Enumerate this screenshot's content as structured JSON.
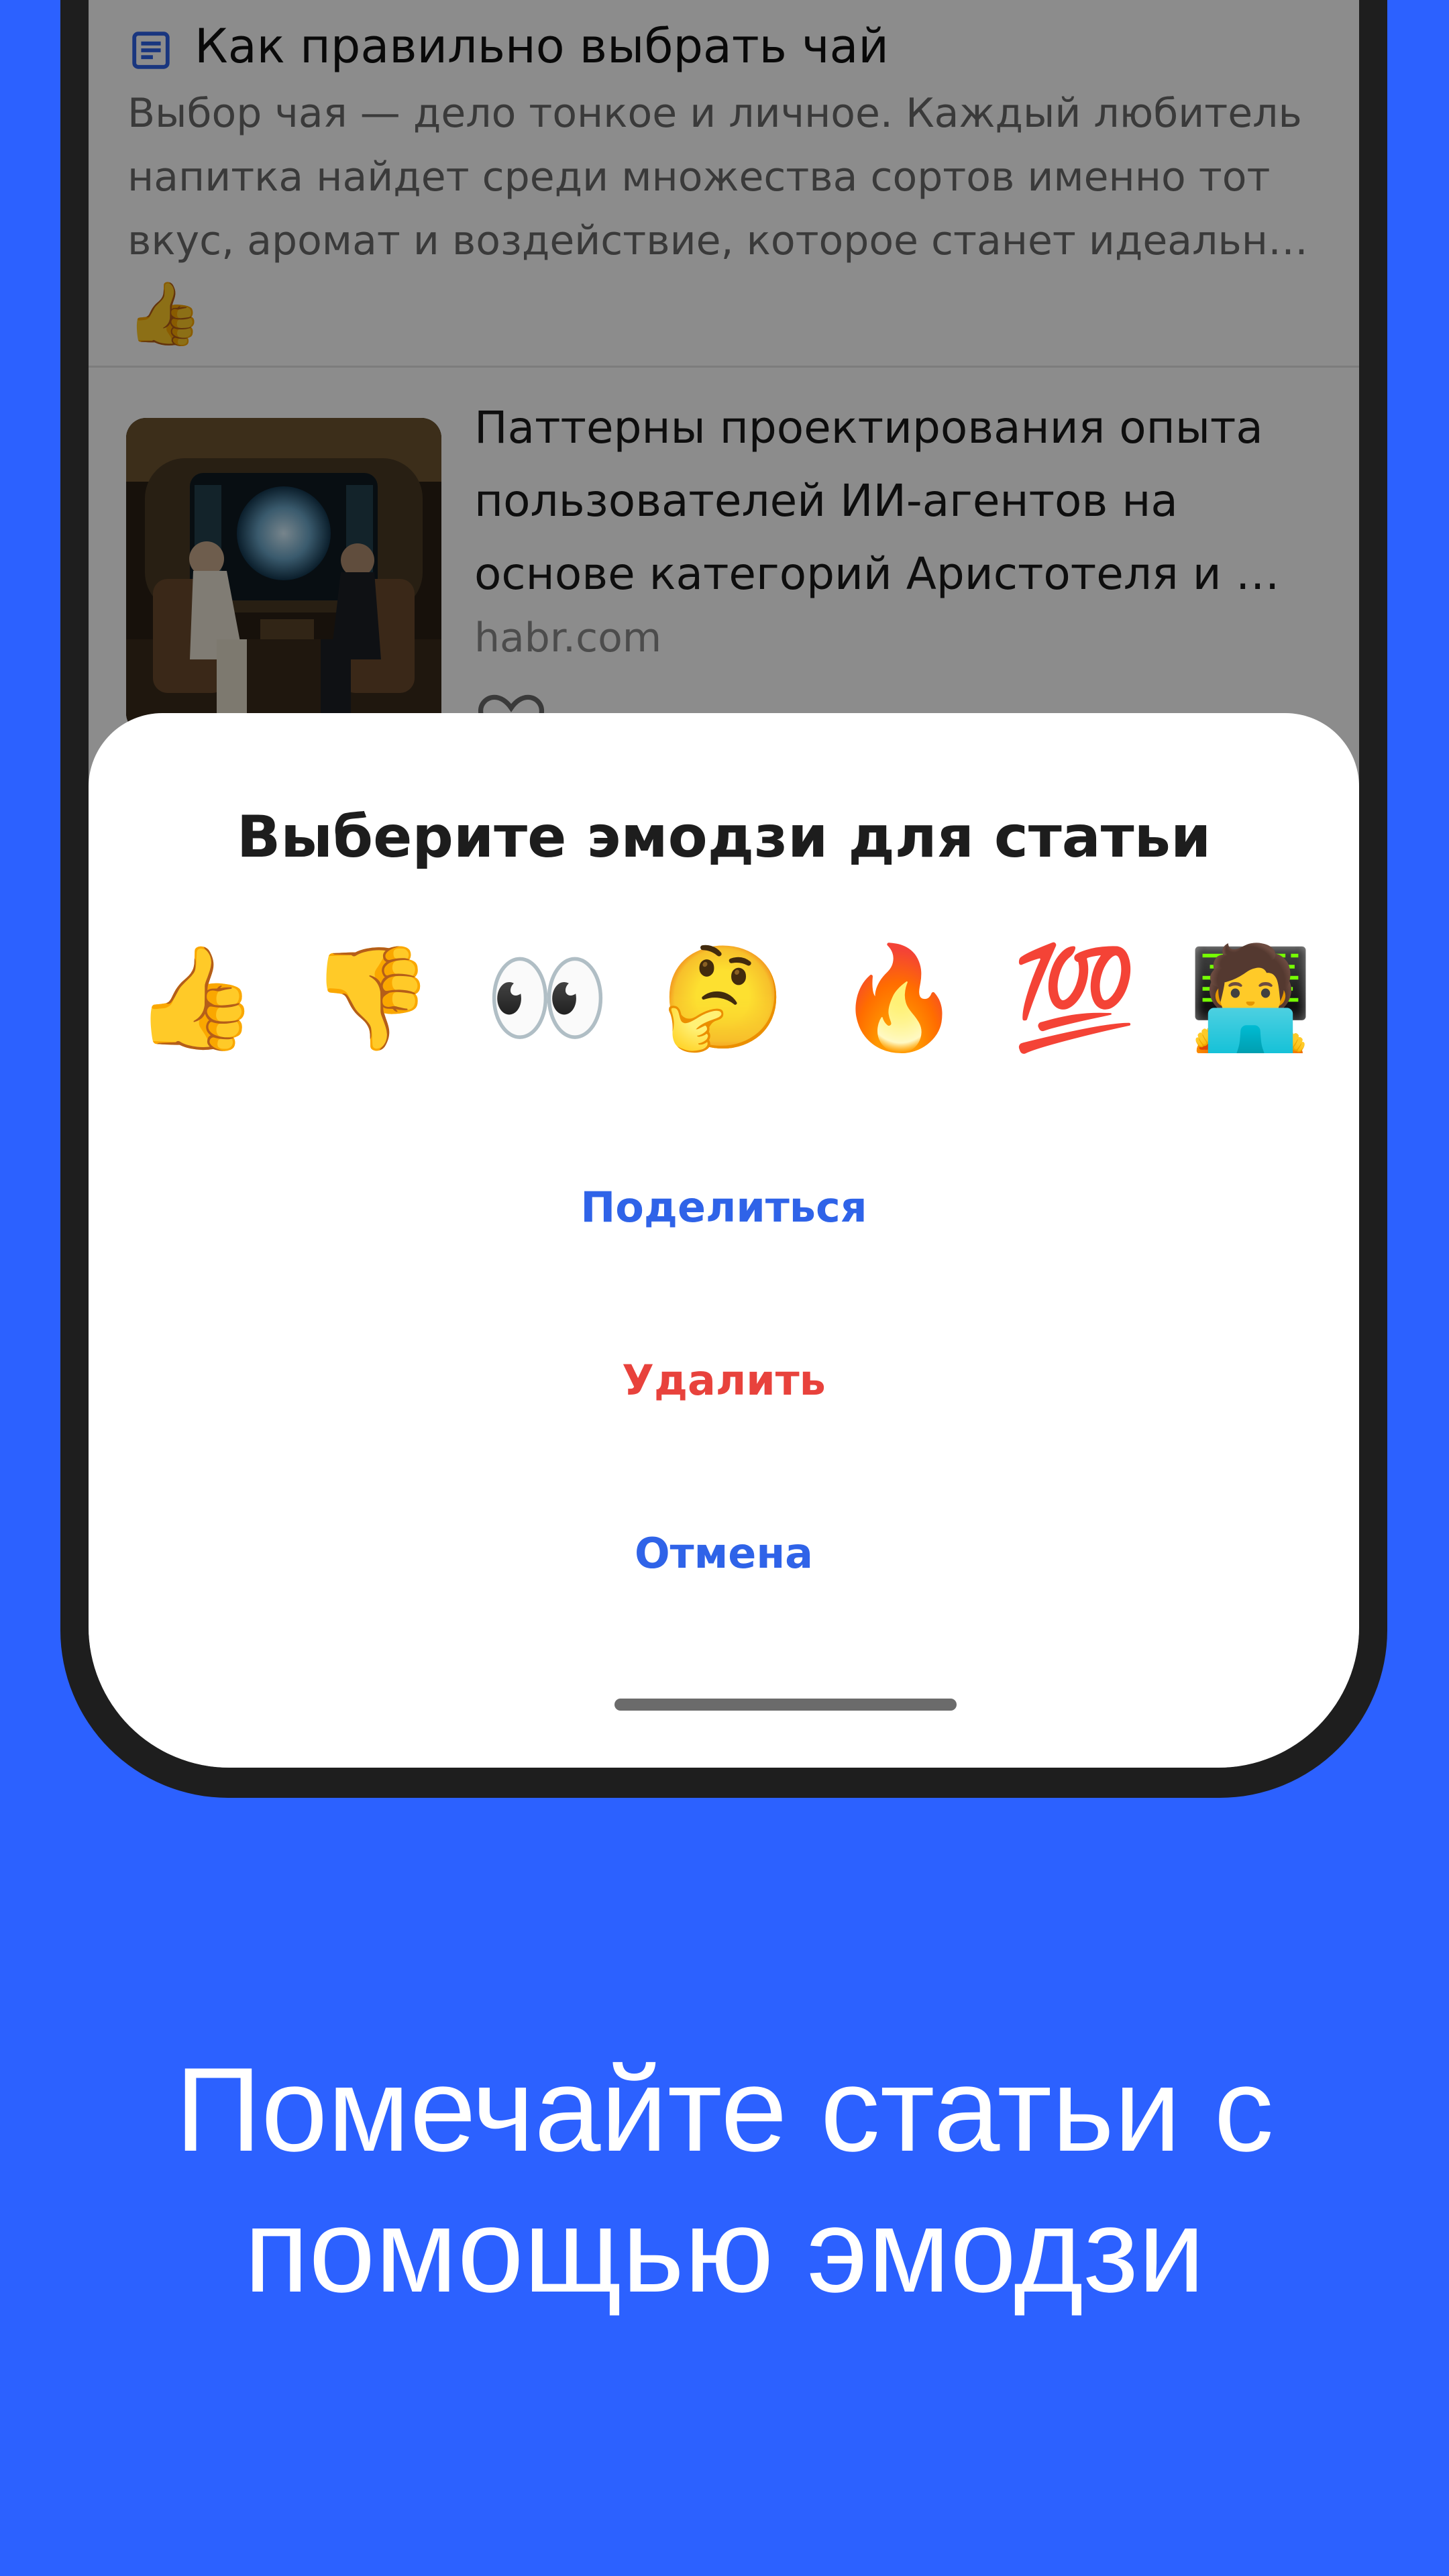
{
  "colors": {
    "background": "#2c61ff",
    "accent": "#2c61ff",
    "share_action": "#2f63e8",
    "delete_action": "#e8423c",
    "cancel_action": "#2f63e8"
  },
  "feed": {
    "note_item": {
      "icon": "document-icon",
      "title": "Как правильно выбрать чай",
      "snippet": "Выбор чая — дело тонкое и личное. Каждый любитель напитка найдет среди множества сортов именно тот вкус, аромат и воздействие, которое станет идеальн…",
      "reaction": "👍"
    },
    "article_item": {
      "title": "Паттерны проектирования опыта пользователей ИИ-агентов на основе категорий Аристотеля и …",
      "source": "habr.com",
      "favorite_icon": "heart-outline-icon"
    }
  },
  "sheet": {
    "title": "Выберите эмодзи для статьи",
    "emojis": [
      "👍",
      "👎",
      "👀",
      "🤔",
      "🔥",
      "💯",
      "🧑‍💻"
    ],
    "share_label": "Поделиться",
    "delete_label": "Удалить",
    "cancel_label": "Отмена"
  },
  "caption": {
    "line1": "Помечайте статьи с",
    "line2": "помощью эмодзи"
  }
}
